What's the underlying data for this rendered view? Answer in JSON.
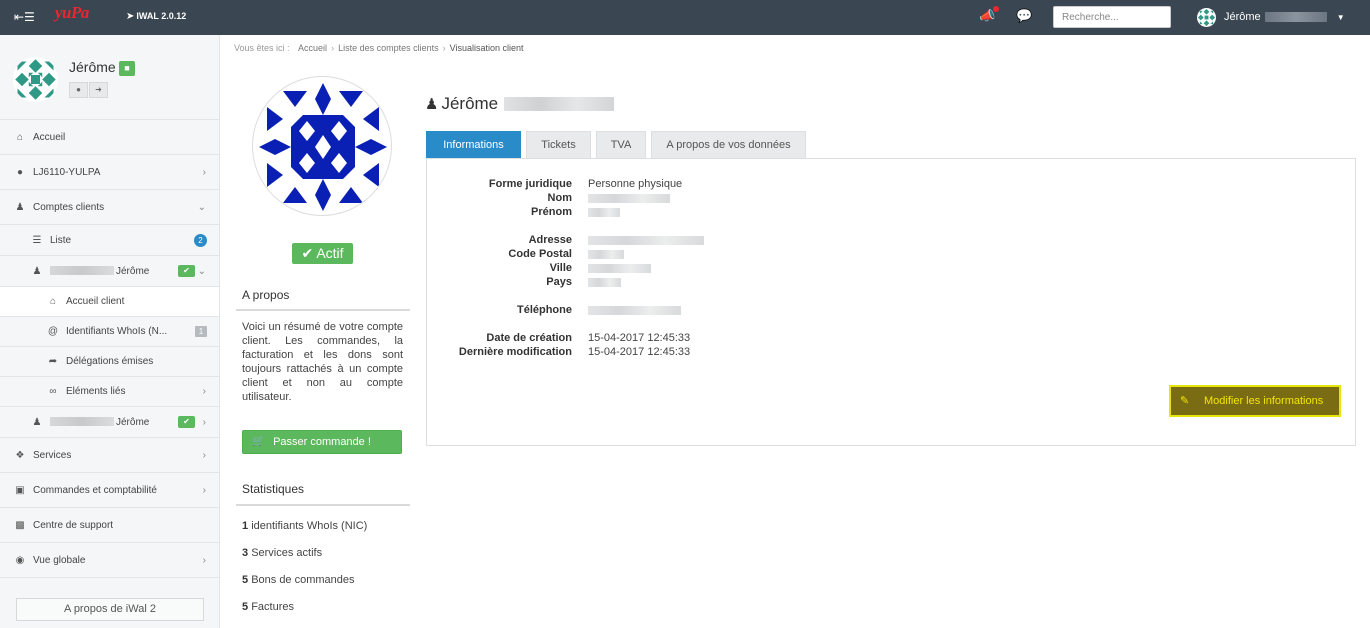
{
  "topbar": {
    "logo": "yuPa",
    "version": "IWAL 2.0.12",
    "search_placeholder": "Recherche...",
    "user_name": "Jérôme"
  },
  "sidebar": {
    "user_name": "Jérôme",
    "items": [
      {
        "label": "Accueil",
        "icon": "home-icon"
      },
      {
        "label": "LJ6110-YULPA",
        "icon": "user-icon"
      },
      {
        "label": "Comptes clients",
        "icon": "person-icon"
      },
      {
        "label": "Liste",
        "icon": "list-icon",
        "badge": "2"
      },
      {
        "label": "Jérôme",
        "icon": "person-icon"
      },
      {
        "label": "Accueil client",
        "icon": "home-icon"
      },
      {
        "label": "Identifiants WhoIs (N...",
        "icon": "at-icon",
        "badge": "1"
      },
      {
        "label": "Délégations émises",
        "icon": "share-icon"
      },
      {
        "label": "Eléments liés",
        "icon": "link-icon"
      },
      {
        "label": "Jérôme",
        "icon": "person-icon"
      },
      {
        "label": "Services",
        "icon": "cubes-icon"
      },
      {
        "label": "Commandes et comptabilité",
        "icon": "cart-icon"
      },
      {
        "label": "Centre de support",
        "icon": "briefcase-icon"
      },
      {
        "label": "Vue globale",
        "icon": "binoculars-icon"
      }
    ],
    "about_button": "A propos de iWal 2"
  },
  "breadcrumb": {
    "prefix": "Vous êtes ici :",
    "items": [
      "Accueil",
      "Liste des comptes clients",
      "Visualisation client"
    ]
  },
  "profile": {
    "status": "Actif",
    "about_title": "A propos",
    "about_text": "Voici un résumé de votre compte client. Les commandes, la facturation et les dons sont toujours rattachés à un compte client et non au compte utilisateur.",
    "order_button": "Passer commande !",
    "stats_title": "Statistiques",
    "stats": [
      {
        "count": "1",
        "label": "identifiants WhoIs (NIC)"
      },
      {
        "count": "3",
        "label": "Services actifs"
      },
      {
        "count": "5",
        "label": "Bons de commandes"
      },
      {
        "count": "5",
        "label": "Factures"
      }
    ]
  },
  "client": {
    "name": "Jérôme",
    "tabs": [
      "Informations",
      "Tickets",
      "TVA",
      "A propos de vos données"
    ],
    "fields": {
      "forme_label": "Forme juridique",
      "forme_value": "Personne physique",
      "nom_label": "Nom",
      "prenom_label": "Prénom",
      "adresse_label": "Adresse",
      "cp_label": "Code Postal",
      "ville_label": "Ville",
      "pays_label": "Pays",
      "tel_label": "Téléphone",
      "creation_label": "Date de création",
      "creation_value": "15-04-2017 12:45:33",
      "modif_label": "Dernière modification",
      "modif_value": "15-04-2017 12:45:33"
    },
    "edit_button": "Modifier les informations"
  },
  "colors": {
    "topbar": "#3a4651",
    "accent": "#2a8bc9",
    "success": "#5cb85c",
    "highlight": "#e6e60a"
  }
}
